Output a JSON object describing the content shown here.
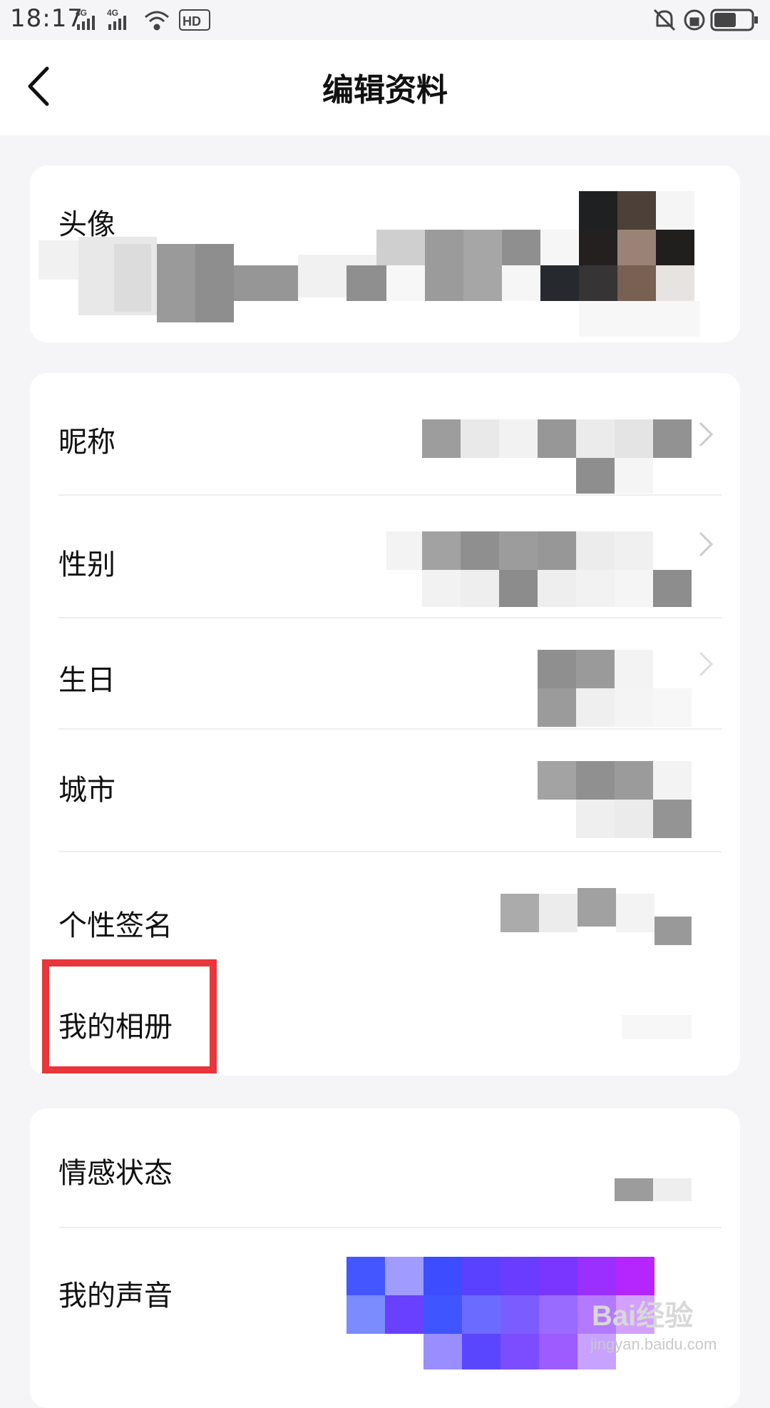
{
  "status_bar": {
    "time": "18:17",
    "left_icons": [
      "4g-signal-icon",
      "4g-signal-icon",
      "wifi-icon",
      "hd-icon"
    ],
    "right_icons": [
      "bell-off-icon",
      "lock-rotation-icon",
      "battery-icon"
    ]
  },
  "nav": {
    "title": "编辑资料"
  },
  "avatar_section": {
    "label": "头像"
  },
  "profile": {
    "rows": [
      {
        "label": "昵称"
      },
      {
        "label": "性别"
      },
      {
        "label": "生日"
      },
      {
        "label": "城市"
      },
      {
        "label": "个性签名"
      },
      {
        "label": "我的相册"
      }
    ]
  },
  "more": {
    "rows": [
      {
        "label": "情感状态"
      },
      {
        "label": "我的声音"
      }
    ]
  },
  "watermark": {
    "logo": "Bai经验",
    "url": "jingyan.baidu.com"
  },
  "colors": {
    "highlight": "#e8363a",
    "background": "#f5f5f7"
  }
}
